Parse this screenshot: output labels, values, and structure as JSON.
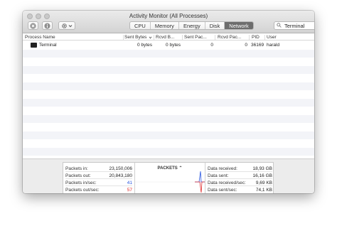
{
  "window": {
    "title": "Activity Monitor (All Processes)"
  },
  "toolbar": {
    "tabs": [
      {
        "label": "CPU",
        "active": false
      },
      {
        "label": "Memory",
        "active": false
      },
      {
        "label": "Energy",
        "active": false
      },
      {
        "label": "Disk",
        "active": false
      },
      {
        "label": "Network",
        "active": true
      }
    ],
    "search_value": "Terminal",
    "icons": [
      "close-process-icon",
      "info-icon",
      "gear-icon",
      "chevron-down-icon",
      "search-icon",
      "clear-search-icon"
    ]
  },
  "table": {
    "columns": [
      "Process Name",
      "Sent Bytes",
      "Rcvd B...",
      "Sent Pac...",
      "Rcvd Pac...",
      "PID",
      "User"
    ],
    "rows": [
      {
        "name": "Terminal",
        "sent_bytes": "0 bytes",
        "rcvd_bytes": "0 bytes",
        "sent_packets": "0",
        "rcvd_packets": "0",
        "pid": "36169",
        "user": "harald"
      }
    ]
  },
  "footer": {
    "left": [
      {
        "label": "Packets in:",
        "value": "23,150,006"
      },
      {
        "label": "Packets out:",
        "value": "20,843,180"
      },
      {
        "label": "Packets in/sec:",
        "value": "41"
      },
      {
        "label": "Packets out/sec:",
        "value": "57"
      }
    ],
    "graph_title": "PACKETS",
    "right": [
      {
        "label": "Data received:",
        "value": "18,93 GB"
      },
      {
        "label": "Data sent:",
        "value": "16,16 GB"
      },
      {
        "label": "Data received/sec:",
        "value": "9,69 KB"
      },
      {
        "label": "Data sent/sec:",
        "value": "74,1 KB"
      }
    ]
  },
  "colors": {
    "packets_in": "#2553e0",
    "packets_out": "#e02a2a"
  }
}
